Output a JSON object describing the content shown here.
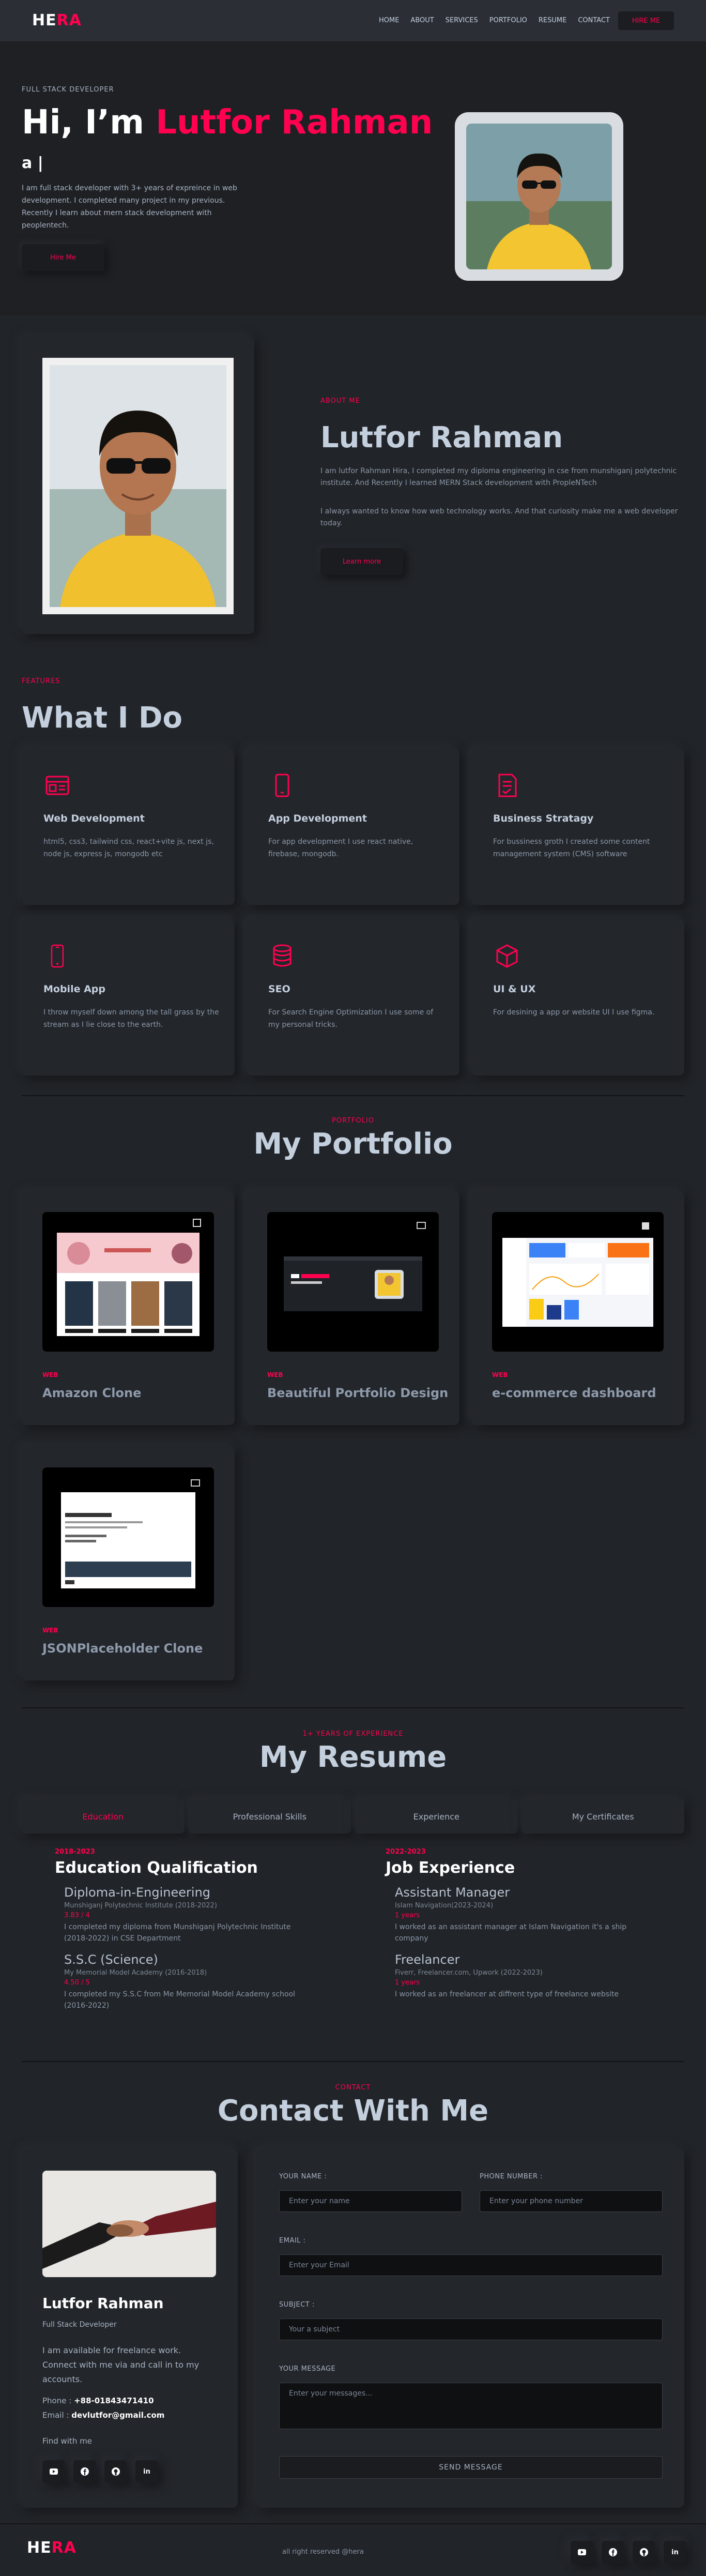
{
  "brand": {
    "first": "HE",
    "second": "RA",
    "accent": "#ff014f"
  },
  "nav": {
    "items": [
      "HOME",
      "ABOUT",
      "SERVICES",
      "PORTFOLIO",
      "RESUME",
      "CONTACT"
    ],
    "hire_label": "HIRE ME"
  },
  "hero": {
    "eyebrow": "FULL STACK DEVELOPER",
    "greeting": "Hi, I’m",
    "name": "Lutfor Rahman",
    "typing": "a |",
    "intro": "I am full stack developer with 3+ years of expreince in web development. I completed many project in my previous. Recently I learn about mern stack development with peoplentech.",
    "button": "Hire Me"
  },
  "about": {
    "eyebrow": "ABOUT ME",
    "name": "Lutfor Rahman",
    "p1": "I am lutfor Rahman Hira, I completed my diploma engineering in cse from munshiganj polytechnic institute. And Recently I learned MERN Stack development with PropleNTech",
    "p2": "I always wanted to know how web technology works. And that curiosity make me a web developer today.",
    "button": "Learn more"
  },
  "features": {
    "eyebrow": "FEATURES",
    "title": "What I Do",
    "items": [
      {
        "icon": "browser-icon",
        "title": "Web Development",
        "text": "html5, css3, tailwind css, react+vite js, next js, node js, express js, mongodb etc"
      },
      {
        "icon": "smartphone-icon",
        "title": "App Development",
        "text": "For app development I use react native, firebase, mongodb."
      },
      {
        "icon": "document-icon",
        "title": "Business Stratagy",
        "text": "For bussiness groth I created some content management system (CMS) software"
      },
      {
        "icon": "mobile-icon",
        "title": "Mobile App",
        "text": "I throw myself down among the tall grass by the stream as I lie close to the earth."
      },
      {
        "icon": "database-icon",
        "title": "SEO",
        "text": "For Search Engine Optimization I use some of my personal tricks."
      },
      {
        "icon": "cube-icon",
        "title": "UI & UX",
        "text": "For desining a app or website UI I use figma."
      }
    ]
  },
  "portfolio": {
    "eyebrow": "PORTFOLIO",
    "title": "My Portfolio",
    "items": [
      {
        "tag": "WEB",
        "title": "Amazon Clone"
      },
      {
        "tag": "WEB",
        "title": "Beautiful Portfolio Design"
      },
      {
        "tag": "WEB",
        "title": "e-commerce dashboard"
      },
      {
        "tag": "WEB",
        "title": "JSONPlaceholder Clone"
      }
    ]
  },
  "resume": {
    "eyebrow": "1+ YEARS OF EXPERIENCE",
    "title": "My Resume",
    "tabs": [
      "Education",
      "Professional Skills",
      "Experience",
      "My Certificates"
    ],
    "education": {
      "years": "2018-2023",
      "heading": "Education Qualification",
      "items": [
        {
          "title": "Diploma-in-Engineering",
          "sub": "Munshiganj Polytechnic Institute (2018-2022)",
          "meta": "3.83 / 4",
          "text": "I completed my diploma from Munshiganj Polytechnic Institute (2018-2022) in CSE Department"
        },
        {
          "title": "S.S.C (Science)",
          "sub": "My Memorial Model Academy (2016-2018)",
          "meta": "4.50 / 5",
          "text": "I completed my S.S.C from Me Memorial Model Academy school (2016-2022)"
        }
      ]
    },
    "job": {
      "years": "2022-2023",
      "heading": "Job Experience",
      "items": [
        {
          "title": "Assistant Manager",
          "sub": "Islam Navigation(2023-2024)",
          "meta": "1 years",
          "text": "I worked as an assistant manager at Islam Navigation it's a ship company"
        },
        {
          "title": "Freelancer",
          "sub": "Fiverr, Freelancer.com, Upwork (2022-2023)",
          "meta": "1 years",
          "text": "I worked as an freelancer at diffrent type of freelance website"
        }
      ]
    }
  },
  "contact": {
    "eyebrow": "CONTACT",
    "title": "Contact With Me",
    "card": {
      "name": "Lutfor Rahman",
      "role": "Full Stack Developer",
      "text": "I am available for freelance work. Connect with me via and call in to my accounts.",
      "phone_label": "Phone :",
      "phone": "+88-01843471410",
      "email_label": "Email :",
      "email": "devlutfor@gmail.com",
      "find": "Find with me",
      "socials": [
        "youtube-icon",
        "facebook-icon",
        "github-icon",
        "linkedin-icon"
      ]
    },
    "form": {
      "name_label": "YOUR NAME :",
      "name_placeholder": "Enter your name",
      "phone_label": "PHONE NUMBER :",
      "phone_placeholder": "Enter your phone number",
      "email_label": "EMAIL :",
      "email_placeholder": "Enter your Email",
      "subject_label": "SUBJECT :",
      "subject_placeholder": "Your a subject",
      "message_label": "YOUR MESSAGE",
      "message_placeholder": "Enter your messages...",
      "send": "SEND MESSAGE"
    }
  },
  "footer": {
    "copyright": "all right reserved @hera",
    "socials": [
      "youtube-icon",
      "facebook-icon",
      "github-icon",
      "linkedin-icon"
    ]
  }
}
